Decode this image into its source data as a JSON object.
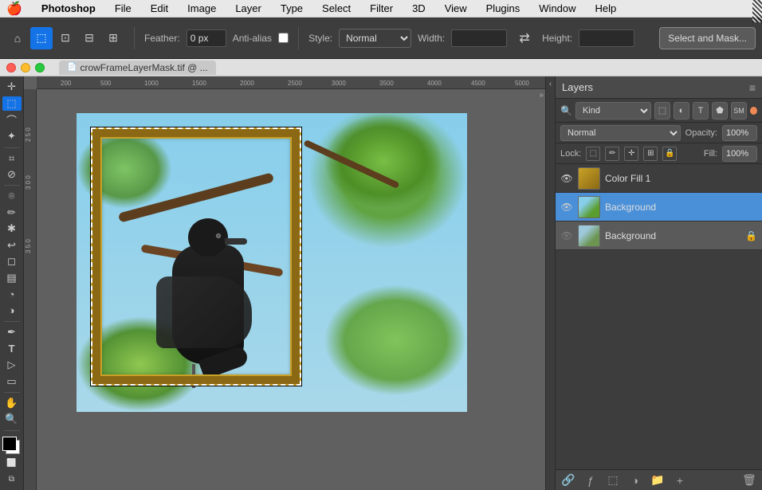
{
  "menubar": {
    "apple": "🍎",
    "items": [
      "Photoshop",
      "File",
      "Edit",
      "Image",
      "Layer",
      "Type",
      "Select",
      "Filter",
      "3D",
      "View",
      "Plugins",
      "Window",
      "Help"
    ]
  },
  "toolbar": {
    "feather_label": "Feather:",
    "feather_value": "0 px",
    "antialias_label": "Anti-alias",
    "style_label": "Style:",
    "style_value": "Normal",
    "width_label": "Width:",
    "width_value": "",
    "height_label": "Height:",
    "height_value": "",
    "select_mask_label": "Select and Mask..."
  },
  "titlebar": {
    "filename": "crowFrameLayerMask.tif @ ..."
  },
  "layers": {
    "panel_title": "Layers",
    "filter_label": "Kind",
    "blend_mode": "Normal",
    "opacity_label": "Opacity:",
    "opacity_value": "100%",
    "lock_label": "Lock:",
    "fill_label": "Fill:",
    "fill_value": "100%",
    "items": [
      {
        "name": "Color Fill 1",
        "visible": true,
        "type": "color-fill",
        "locked": false,
        "active": false
      },
      {
        "name": "Background",
        "visible": true,
        "type": "bg-masked",
        "locked": false,
        "active": true
      },
      {
        "name": "Background",
        "visible": false,
        "type": "bg-original",
        "locked": true,
        "active": false
      }
    ]
  },
  "tools": {
    "items": [
      {
        "icon": "⊕",
        "name": "move-tool"
      },
      {
        "icon": "⬚",
        "name": "marquee-tool"
      },
      {
        "icon": "↖",
        "name": "lasso-tool"
      },
      {
        "icon": "✧",
        "name": "magic-wand-tool"
      },
      {
        "icon": "✂",
        "name": "crop-tool"
      },
      {
        "icon": "⟦⟧",
        "name": "slice-tool"
      },
      {
        "icon": "⌖",
        "name": "eyedropper-tool"
      },
      {
        "icon": "✎",
        "name": "healing-brush-tool"
      },
      {
        "icon": "✏",
        "name": "brush-tool"
      },
      {
        "icon": "⎍",
        "name": "clone-stamp-tool"
      },
      {
        "icon": "◐",
        "name": "history-brush-tool"
      },
      {
        "icon": "◻",
        "name": "eraser-tool"
      },
      {
        "icon": "▓",
        "name": "gradient-tool"
      },
      {
        "icon": "◯",
        "name": "blur-tool"
      },
      {
        "icon": "⬤",
        "name": "dodge-tool"
      },
      {
        "icon": "✦",
        "name": "pen-tool"
      },
      {
        "icon": "T",
        "name": "type-tool"
      },
      {
        "icon": "⬦",
        "name": "path-selection-tool"
      },
      {
        "icon": "▭",
        "name": "shape-tool"
      },
      {
        "icon": "☞",
        "name": "3d-tool"
      },
      {
        "icon": "🔍",
        "name": "zoom-tool"
      },
      {
        "icon": "✋",
        "name": "hand-tool"
      }
    ]
  }
}
